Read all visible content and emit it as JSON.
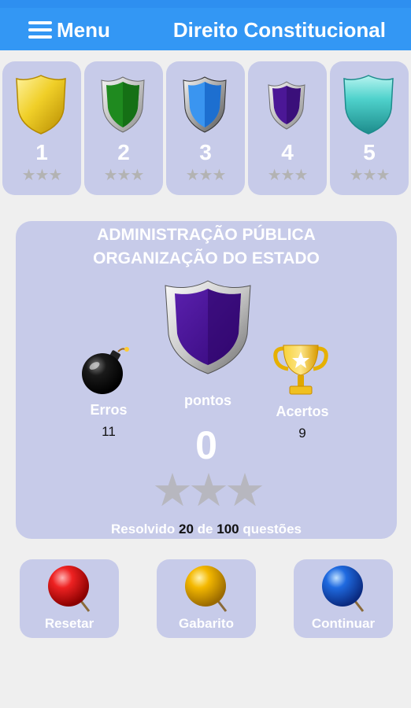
{
  "appbar": {
    "menu_label": "Menu",
    "title": "Direito Constitucional"
  },
  "levels": [
    {
      "number": "1",
      "stars": "★★★",
      "shield_color": "#e8c21a",
      "stars_earned": 0
    },
    {
      "number": "2",
      "stars": "★★★",
      "shield_color": "#1f8a1f",
      "stars_earned": 0
    },
    {
      "number": "3",
      "stars": "★★★",
      "shield_color": "#2a86e8",
      "stars_earned": 0
    },
    {
      "number": "4",
      "stars": "★★★",
      "shield_color": "#4b1796",
      "stars_earned": 0
    },
    {
      "number": "5",
      "stars": "★★★",
      "shield_color": "#36b9b9",
      "stars_earned": 0
    }
  ],
  "panel": {
    "line1": "ADMINISTRAÇÃO PÚBLICA",
    "line2": "ORGANIZAÇÃO DO ESTADO",
    "shield_color": "#4b1796",
    "errors_label": "Erros",
    "errors_value": "11",
    "points_label": "pontos",
    "points_value": "0",
    "hits_label": "Acertos",
    "hits_value": "9",
    "stars": "★★★",
    "stars_earned": 0,
    "resolved_prefix": "Resolvido",
    "resolved_count": "20",
    "resolved_mid": "de",
    "resolved_total": "100",
    "resolved_suffix": "questões"
  },
  "actions": {
    "reset_label": "Resetar",
    "answers_label": "Gabarito",
    "continue_label": "Continuar"
  },
  "colors": {
    "appbar": "#3397f4",
    "card": "#c7cbe9",
    "reset_pin": "#e2161a",
    "answers_pin": "#f2b400",
    "continue_pin": "#1e62d6"
  }
}
